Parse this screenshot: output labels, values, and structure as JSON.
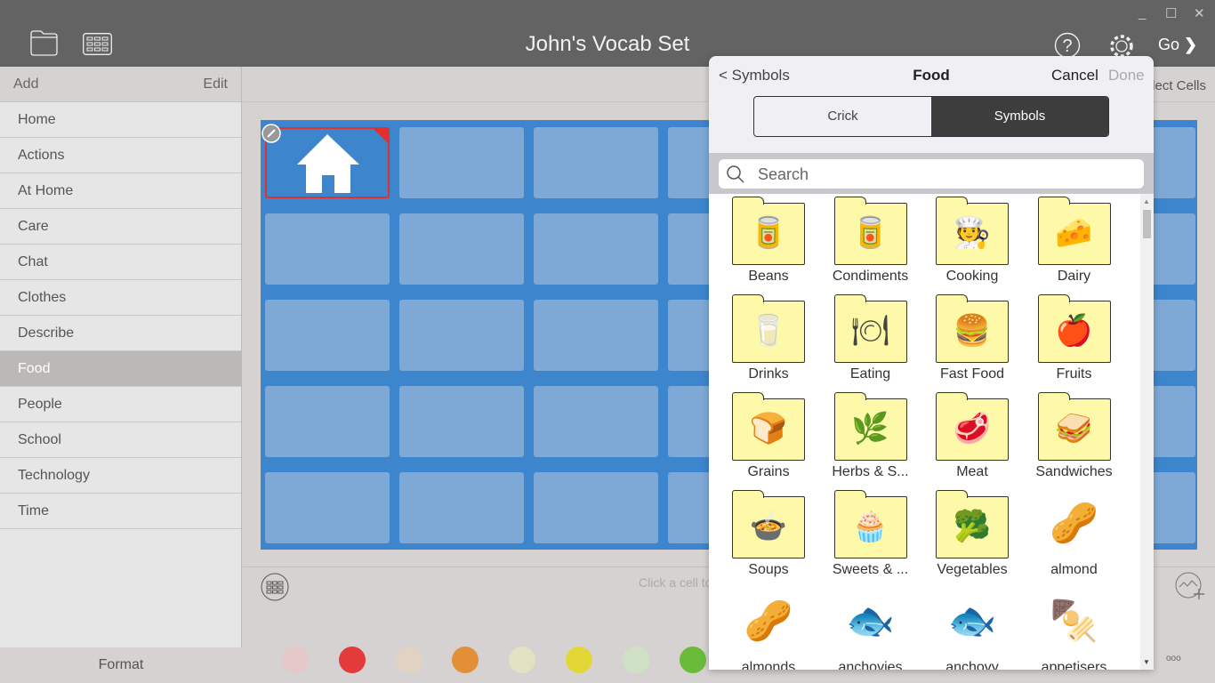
{
  "window": {
    "title": "John's Vocab Set",
    "minimize": "_",
    "maximize": "☐",
    "close": "✕",
    "go_label": "Go"
  },
  "sidebar": {
    "add": "Add",
    "edit": "Edit",
    "format": "Format",
    "selected": "Food",
    "items": [
      "Home",
      "Actions",
      "At Home",
      "Care",
      "Chat",
      "Clothes",
      "Describe",
      "Food",
      "People",
      "School",
      "Technology",
      "Time"
    ]
  },
  "main": {
    "select_cells": "Select Cells",
    "hint": "Click a cell to",
    "more": "ooo",
    "colors": [
      "#e6c8c8",
      "#e33b3b",
      "#e1d2c2",
      "#e38f37",
      "#e2e2c2",
      "#e3d736",
      "#cfe1c5",
      "#6abb3a"
    ]
  },
  "popup": {
    "back": "< Symbols",
    "title": "Food",
    "cancel": "Cancel",
    "done": "Done",
    "tabs": [
      {
        "label": "Crick",
        "active": false
      },
      {
        "label": "Symbols",
        "active": true
      }
    ],
    "search_placeholder": "Search",
    "symbols": [
      {
        "label": "Beans",
        "folder": true,
        "icon": "🥫"
      },
      {
        "label": "Condiments",
        "folder": true,
        "icon": "🥫"
      },
      {
        "label": "Cooking",
        "folder": true,
        "icon": "🧑‍🍳"
      },
      {
        "label": "Dairy",
        "folder": true,
        "icon": "🧀"
      },
      {
        "label": "Drinks",
        "folder": true,
        "icon": "🥛"
      },
      {
        "label": "Eating",
        "folder": true,
        "icon": "🍽"
      },
      {
        "label": "Fast Food",
        "folder": true,
        "icon": "🍔"
      },
      {
        "label": "Fruits",
        "folder": true,
        "icon": "🍎"
      },
      {
        "label": "Grains",
        "folder": true,
        "icon": "🍞"
      },
      {
        "label": "Herbs & S...",
        "folder": true,
        "icon": "🌿"
      },
      {
        "label": "Meat",
        "folder": true,
        "icon": "🥩"
      },
      {
        "label": "Sandwiches",
        "folder": true,
        "icon": "🥪"
      },
      {
        "label": "Soups",
        "folder": true,
        "icon": "🍲"
      },
      {
        "label": "Sweets & ...",
        "folder": true,
        "icon": "🧁"
      },
      {
        "label": "Vegetables",
        "folder": true,
        "icon": "🥦"
      },
      {
        "label": "almond",
        "folder": false,
        "icon": "🥜"
      },
      {
        "label": "almonds",
        "folder": false,
        "icon": "🥜"
      },
      {
        "label": "anchovies",
        "folder": false,
        "icon": "🐟"
      },
      {
        "label": "anchovy",
        "folder": false,
        "icon": "🐟"
      },
      {
        "label": "appetisers",
        "folder": false,
        "icon": "🍢"
      }
    ]
  }
}
